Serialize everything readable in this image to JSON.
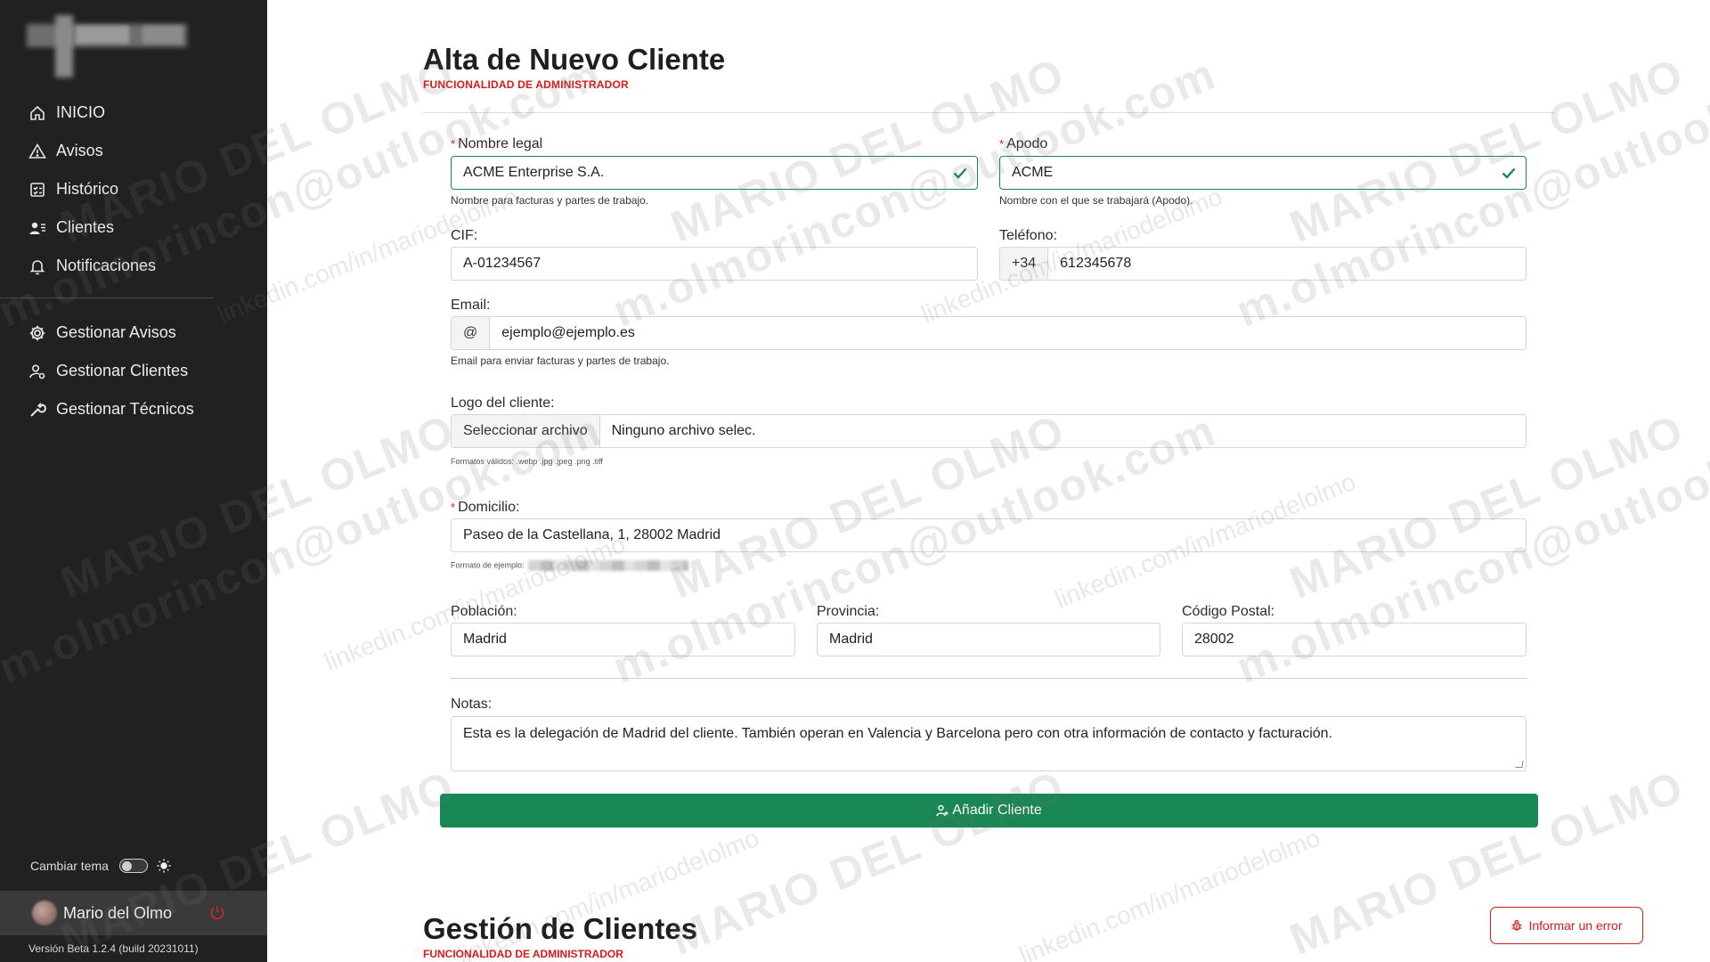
{
  "sidebar": {
    "nav": [
      {
        "label": "INICIO",
        "icon": "home-icon"
      },
      {
        "label": "Avisos",
        "icon": "warning-icon"
      },
      {
        "label": "Histórico",
        "icon": "checklist-icon"
      },
      {
        "label": "Clientes",
        "icon": "users-icon"
      },
      {
        "label": "Notificaciones",
        "icon": "bell-icon"
      }
    ],
    "admin_nav": [
      {
        "label": "Gestionar Avisos",
        "icon": "gear-icon"
      },
      {
        "label": "Gestionar Clientes",
        "icon": "user-gear-icon"
      },
      {
        "label": "Gestionar Técnicos",
        "icon": "wrench-icon"
      }
    ],
    "theme_label": "Cambiar tema",
    "user_name": "Mario del Olmo",
    "version": "Versión Beta 1.2.4 (build 20231011)"
  },
  "form": {
    "title": "Alta de Nuevo Cliente",
    "subtitle": "FUNCIONALIDAD DE ADMINISTRADOR",
    "nombre_label": "Nombre legal",
    "nombre_value": "ACME Enterprise  S.A.",
    "nombre_help": "Nombre para facturas y partes de trabajo.",
    "apodo_label": "Apodo",
    "apodo_value": "ACME",
    "apodo_help": "Nombre con el que se trabajará (Apodo).",
    "cif_label": "CIF:",
    "cif_value": "A-01234567",
    "telefono_label": "Teléfono:",
    "telefono_prefix": "+34",
    "telefono_value": "612345678",
    "email_label": "Email:",
    "email_prefix": "@",
    "email_value": "ejemplo@ejemplo.es",
    "email_help": "Email para enviar facturas y partes de trabajo.",
    "logo_label": "Logo del cliente:",
    "logo_button": "Seleccionar archivo",
    "logo_value": "Ninguno archivo selec.",
    "logo_help": "Formatos válidos: .webp .jpg .jpeg .png .tiff",
    "domicilio_label": "Domicilio:",
    "domicilio_value": "Paseo de la Castellana, 1, 28002 Madrid",
    "domicilio_help": "Formato de ejemplo:",
    "poblacion_label": "Población:",
    "poblacion_value": "Madrid",
    "provincia_label": "Provincia:",
    "provincia_value": "Madrid",
    "cp_label": "Código Postal:",
    "cp_value": "28002",
    "notas_label": "Notas:",
    "notas_value": "Esta es la delegación de Madrid del cliente. También operan en Valencia y Barcelona pero con otra información de contacto y facturación.",
    "submit_label": "Añadir Cliente"
  },
  "gestion": {
    "title": "Gestión de Clientes",
    "subtitle": "FUNCIONALIDAD DE ADMINISTRADOR"
  },
  "report_button": "Informar un error",
  "watermark": {
    "name": "MARIO DEL OLMO",
    "email": "m.olmorincon@outlook.com",
    "linkedin": "linkedin.com/in/mariodelolmo"
  },
  "colors": {
    "sidebar_bg": "#212121",
    "accent_green": "#198754",
    "accent_red": "#d71a1a"
  }
}
